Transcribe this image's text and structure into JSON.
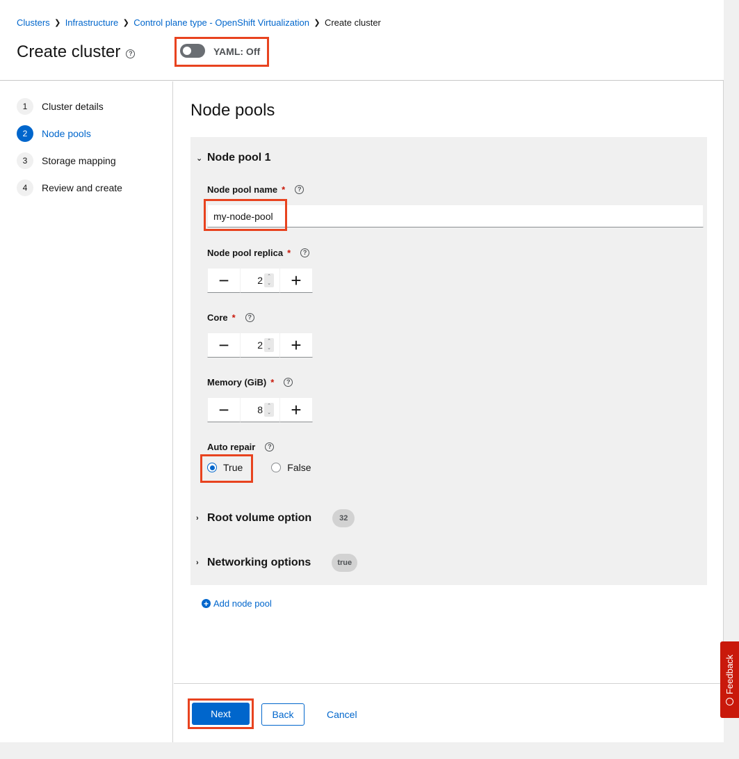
{
  "breadcrumb": {
    "items": [
      "Clusters",
      "Infrastructure",
      "Control plane type - OpenShift Virtualization"
    ],
    "current": "Create cluster"
  },
  "header": {
    "title": "Create cluster",
    "yaml_toggle_label": "YAML: Off"
  },
  "wizard": {
    "steps": [
      {
        "num": "1",
        "label": "Cluster details"
      },
      {
        "num": "2",
        "label": "Node pools"
      },
      {
        "num": "3",
        "label": "Storage mapping"
      },
      {
        "num": "4",
        "label": "Review and create"
      }
    ]
  },
  "main": {
    "section_title": "Node pools",
    "node_pool": {
      "title": "Node pool 1",
      "name_label": "Node pool name",
      "name_value": "my-node-pool",
      "replica_label": "Node pool replica",
      "replica_value": "2",
      "core_label": "Core",
      "core_value": "2",
      "memory_label": "Memory (GiB)",
      "memory_value": "8",
      "auto_repair_label": "Auto repair",
      "auto_repair_true": "True",
      "auto_repair_false": "False",
      "root_volume_label": "Root volume option",
      "root_volume_badge": "32",
      "networking_label": "Networking options",
      "networking_badge": "true"
    },
    "add_node_pool": "Add node pool",
    "required_mark": "*"
  },
  "footer": {
    "next": "Next",
    "back": "Back",
    "cancel": "Cancel"
  },
  "feedback_label": "Feedback",
  "colors": {
    "accent": "#0066cc",
    "highlight": "#e8431f",
    "feedback": "#c9190b"
  }
}
